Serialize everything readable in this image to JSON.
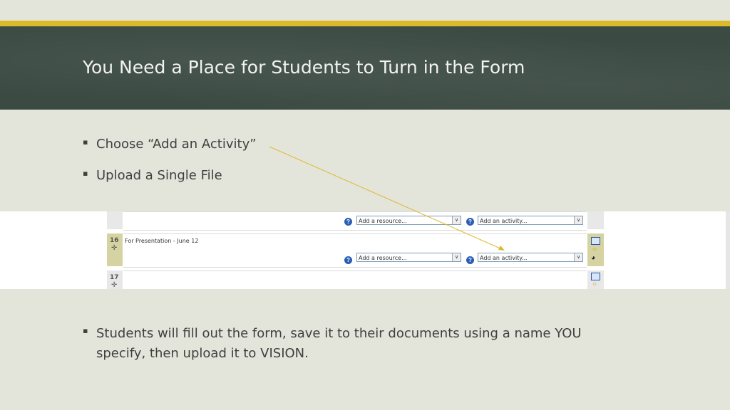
{
  "slide": {
    "title": "You Need a Place for Students to Turn in the Form",
    "bullets": [
      "Choose “Add an Activity”",
      "Upload a Single File",
      "Students will fill out the form, save it to their documents using a name YOU specify, then upload it to VISION."
    ],
    "bullet_glyph": "▪"
  },
  "screenshot": {
    "rows": [
      {
        "number": "",
        "topic": "",
        "resource_select": "Add a resource...",
        "activity_select": "Add an activity..."
      },
      {
        "number": "16",
        "topic": "For Presentation - June 12",
        "resource_select": "Add a resource...",
        "activity_select": "Add an activity..."
      },
      {
        "number": "17",
        "topic": ""
      }
    ],
    "help_glyph": "?",
    "dropdown_glyph": "∨",
    "move_glyph": "✛"
  },
  "colors": {
    "accent": "#dcb928",
    "header": "#3b4a43",
    "background": "#e3e5da",
    "annotation_line": "#e0b830"
  }
}
